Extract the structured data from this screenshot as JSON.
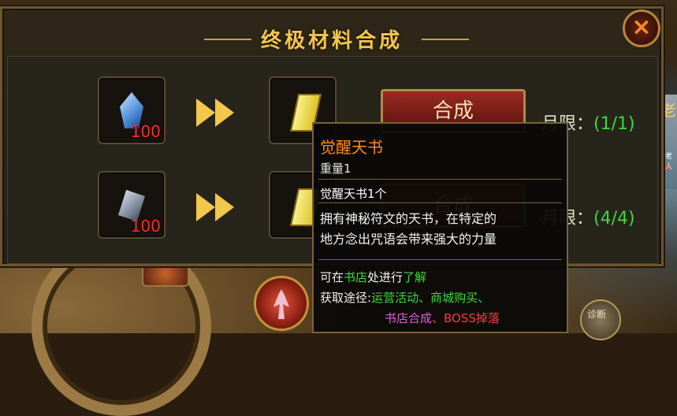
{
  "title": "终极材料合成",
  "close_label": "×",
  "recipes": [
    {
      "input_count": "100",
      "button_label": "合成",
      "limit_label": "月限：",
      "limit_value": "(1/1)"
    },
    {
      "input_count": "100",
      "button_label": "合成",
      "limit_label": "月限：",
      "limit_value": "(4/4)"
    }
  ],
  "tooltip": {
    "name": "觉醒天书",
    "weight": "重量1",
    "item_line": "觉醒天书1个",
    "description_line1": "拥有神秘符文的天书，在特定的",
    "description_line2": "地方念出咒语会带来强大的力量",
    "source_prefix": "可在",
    "source_shop": "书店",
    "source_mid": "处进行",
    "source_learn": "了解",
    "acquire_label": "获取途径:",
    "acquire_1": "运营活动",
    "sep1": "、",
    "acquire_2": "商城购买",
    "sep2": "、",
    "acquire_3": "书店合成",
    "sep3": "、",
    "acquire_4": "BOSS掉落"
  },
  "side": {
    "npc_char": "老",
    "npc_tiny1": "老人",
    "npc_tiny2": "系",
    "bottom_button": "诊断"
  },
  "colors": {
    "title": "#f3c64d",
    "limit_value": "#3cd83c",
    "item_name": "#ff8c1a",
    "count": "#ff2a2a"
  }
}
